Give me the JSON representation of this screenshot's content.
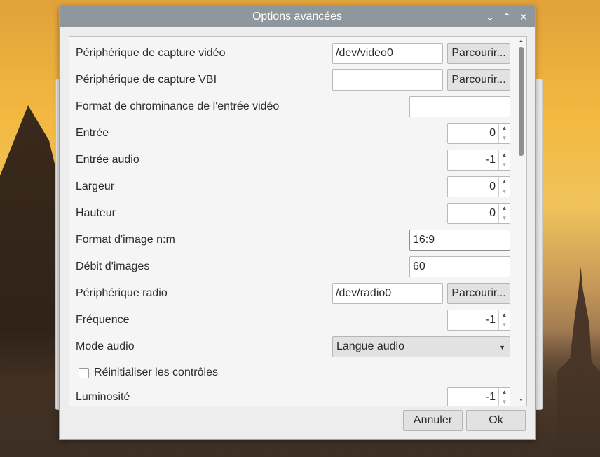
{
  "dialog": {
    "title": "Options avancées"
  },
  "titlebar": {
    "minimize": "⌄",
    "maximize": "⌃",
    "close": "✕"
  },
  "fields": {
    "video_device": {
      "label": "Périphérique de capture vidéo",
      "value": "/dev/video0",
      "browse": "Parcourir..."
    },
    "vbi_device": {
      "label": "Périphérique de capture VBI",
      "value": "",
      "browse": "Parcourir..."
    },
    "chroma_format": {
      "label": "Format de chrominance de l'entrée vidéo",
      "value": ""
    },
    "input": {
      "label": "Entrée",
      "value": "0"
    },
    "audio_input": {
      "label": "Entrée audio",
      "value": "-1"
    },
    "width": {
      "label": "Largeur",
      "value": "0"
    },
    "height": {
      "label": "Hauteur",
      "value": "0"
    },
    "aspect_ratio": {
      "label": "Format d'image n:m",
      "value": "16:9"
    },
    "frame_rate": {
      "label": "Débit d'images",
      "value": "60"
    },
    "radio_device": {
      "label": "Périphérique radio",
      "value": "/dev/radio0",
      "browse": "Parcourir..."
    },
    "frequency": {
      "label": "Fréquence",
      "value": "-1"
    },
    "audio_mode": {
      "label": "Mode audio",
      "value": "Langue audio"
    },
    "reset_controls": {
      "label": "Réinitialiser les contrôles",
      "checked": false
    },
    "brightness": {
      "label": "Luminosité",
      "value": "-1"
    }
  },
  "buttons": {
    "cancel": "Annuler",
    "ok": "Ok"
  }
}
